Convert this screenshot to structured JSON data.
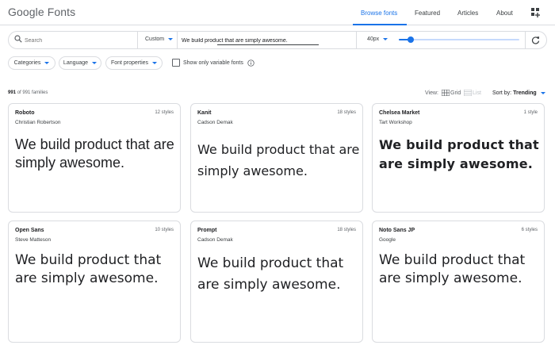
{
  "header": {
    "logo": "Google Fonts",
    "nav": [
      {
        "label": "Browse fonts",
        "active": true
      },
      {
        "label": "Featured",
        "active": false
      },
      {
        "label": "Articles",
        "active": false
      },
      {
        "label": "About",
        "active": false
      }
    ],
    "apps_icon": "add-apps-icon"
  },
  "toolbar": {
    "search_placeholder": "Search",
    "sentence_type": "Custom",
    "preview_text": "We build product that are simply awesome.",
    "font_size": "40px",
    "size_slider_fraction": 0.08,
    "refresh_icon": "refresh-icon"
  },
  "filters": {
    "categories": "Categories",
    "language": "Language",
    "font_properties": "Font properties",
    "variable_only": "Show only variable fonts",
    "variable_checked": false,
    "info_icon": "info-icon"
  },
  "results": {
    "count": "991",
    "count_suffix": "of 991 families",
    "view_label": "View:",
    "grid_label": "Grid",
    "list_label": "List",
    "sort_prefix": "Sort by:",
    "sort_value": "Trending"
  },
  "cards": [
    {
      "name": "Roboto",
      "author": "Christian Robertson",
      "styles": "12 styles",
      "preview": "We build product that are simply awesome."
    },
    {
      "name": "Kanit",
      "author": "Cadson Demak",
      "styles": "18 styles",
      "preview": "We build product that are simply awesome."
    },
    {
      "name": "Chelsea Market",
      "author": "Tart Workshop",
      "styles": "1 style",
      "preview": "We build product that are simply awesome."
    },
    {
      "name": "Open Sans",
      "author": "Steve Matteson",
      "styles": "10 styles",
      "preview": "We build product that are simply awesome."
    },
    {
      "name": "Prompt",
      "author": "Cadson Demak",
      "styles": "18 styles",
      "preview": "We build product that are simply awesome."
    },
    {
      "name": "Noto Sans JP",
      "author": "Google",
      "styles": "6 styles",
      "preview": "We build product that are simply awesome."
    }
  ],
  "colors": {
    "accent": "#1a73e8",
    "border": "#dadce0",
    "text": "#202124",
    "muted": "#5f6368"
  }
}
